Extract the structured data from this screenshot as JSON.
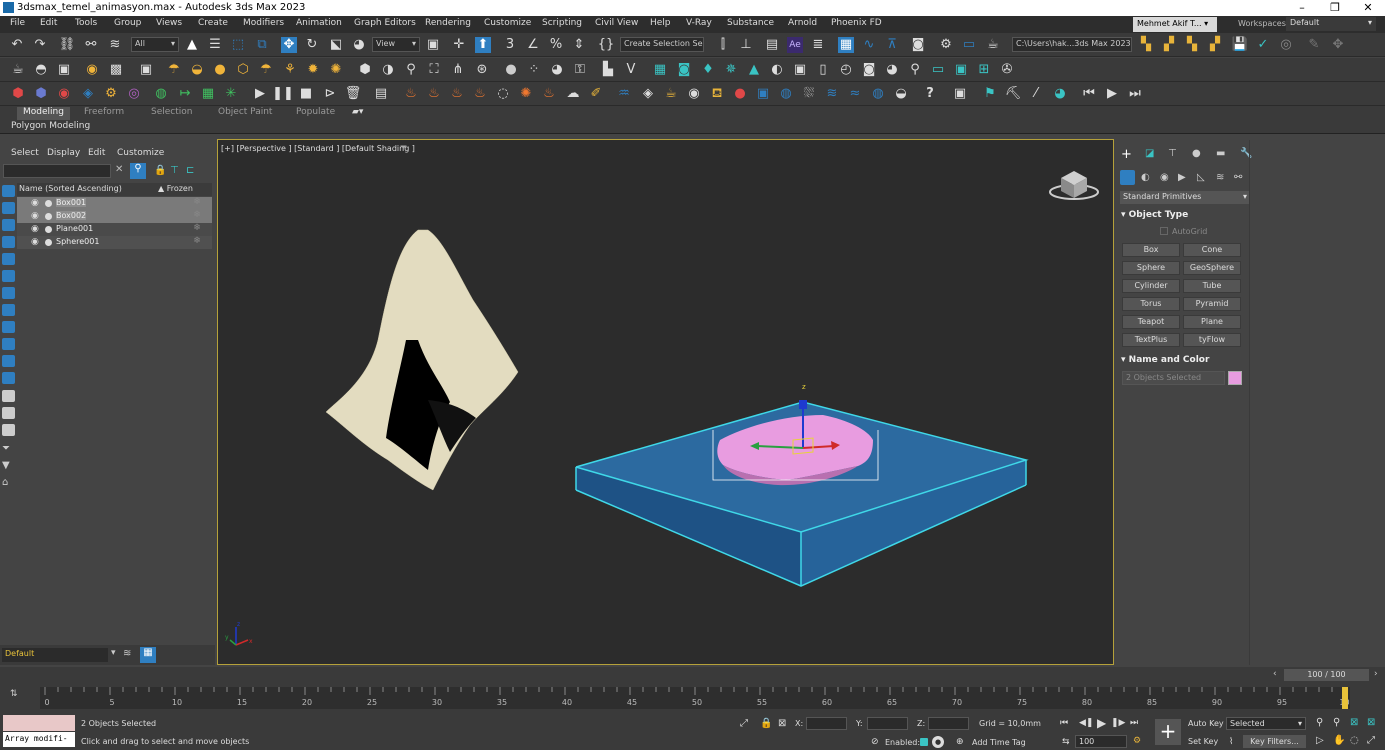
{
  "window": {
    "title": "3dsmax_temel_animasyon.max - Autodesk 3ds Max 2023"
  },
  "menu": {
    "items": [
      "File",
      "Edit",
      "Tools",
      "Group",
      "Views",
      "Create",
      "Modifiers",
      "Animation",
      "Graph Editors",
      "Rendering",
      "Customize",
      "Scripting",
      "Civil View",
      "Help",
      "V-Ray",
      "Substance",
      "Arnold",
      "Phoenix FD"
    ],
    "user": "Mehmet Akif T...",
    "workspaces_label": "Workspaces:",
    "workspaces_value": "Default"
  },
  "toolbar": {
    "filter_value": "All",
    "view_value": "View",
    "selection_set_placeholder": "Create Selection Se",
    "project_path": "C:\\Users\\hak...3ds Max 2023"
  },
  "ribbon": {
    "tabs": [
      "Modeling",
      "Freeform",
      "Selection",
      "Object Paint",
      "Populate"
    ],
    "active_tab": "Modeling",
    "subpanel": "Polygon Modeling"
  },
  "explorer": {
    "menu": [
      "Select",
      "Display",
      "Edit",
      "Customize"
    ],
    "col_name": "Name (Sorted Ascending)",
    "col_frozen": "▲ Frozen",
    "rows": [
      {
        "name": "Box001",
        "selected": true
      },
      {
        "name": "Box002",
        "selected": true
      },
      {
        "name": "Plane001",
        "selected": false
      },
      {
        "name": "Sphere001",
        "selected": false
      }
    ],
    "layer": "Default"
  },
  "viewport": {
    "label": "[+] [Perspective ] [Standard ] [Default Shading ]",
    "axis_labels": {
      "x": "x",
      "y": "y",
      "z": "z"
    }
  },
  "command_panel": {
    "category": "Standard Primitives",
    "object_type_title": "Object Type",
    "autogrid": "AutoGrid",
    "buttons": [
      "Box",
      "Cone",
      "Sphere",
      "GeoSphere",
      "Cylinder",
      "Tube",
      "Torus",
      "Pyramid",
      "Teapot",
      "Plane",
      "TextPlus",
      "tyFlow"
    ],
    "name_color_title": "Name and Color",
    "name_field": "2 Objects Selected",
    "color": "#e89ce0"
  },
  "timeline": {
    "frame_display": "100 / 100",
    "ticks": [
      "0",
      "5",
      "10",
      "15",
      "20",
      "25",
      "30",
      "35",
      "40",
      "45",
      "50",
      "55",
      "60",
      "65",
      "70",
      "75",
      "80",
      "85",
      "90",
      "95",
      "100"
    ],
    "current_frame": 100
  },
  "status": {
    "maxscript": "Array modifi-",
    "objects_selected": "2 Objects Selected",
    "prompt": "Click and drag to select and move objects",
    "x_label": "X:",
    "y_label": "Y:",
    "z_label": "Z:",
    "grid": "Grid = 10,0mm",
    "enabled": "Enabled:",
    "add_time_tag": "Add Time Tag",
    "frame_field": "100",
    "auto_key": "Auto Key",
    "set_key": "Set Key",
    "selected_value": "Selected",
    "key_filters": "Key Filters..."
  },
  "colors": {
    "accent": "#2f7fc1",
    "selection": "#3fd8e8",
    "cloth": "#e3dcc0",
    "box_blue": "#2c6aa0",
    "pillow": "#e89ce0"
  }
}
